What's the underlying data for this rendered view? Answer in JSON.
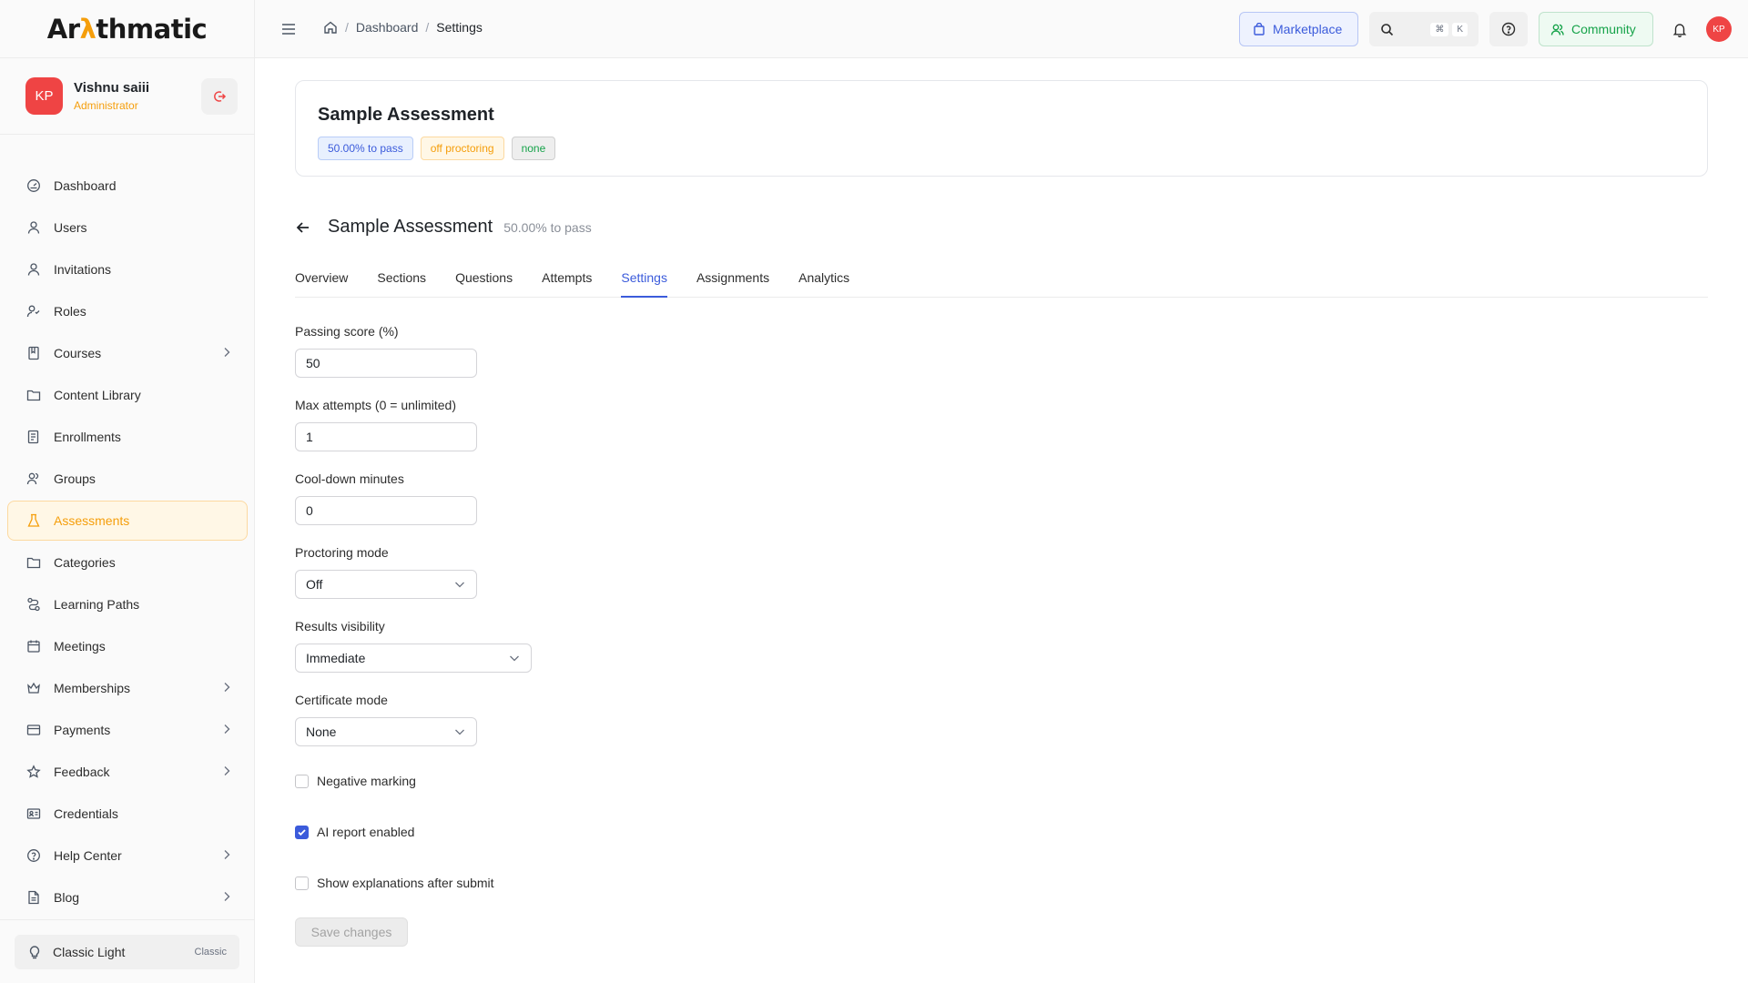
{
  "brand": {
    "logo_prefix": "Ar",
    "logo_accent": "λ",
    "logo_suffix": "thmatic"
  },
  "user": {
    "initials": "KP",
    "name": "Vishnu saiii",
    "role": "Administrator"
  },
  "sidebar": {
    "items": [
      {
        "label": "Dashboard",
        "icon": "dashboard-icon",
        "has_children": false
      },
      {
        "label": "Users",
        "icon": "user-icon",
        "has_children": false
      },
      {
        "label": "Invitations",
        "icon": "user-icon",
        "has_children": false
      },
      {
        "label": "Roles",
        "icon": "roles-icon",
        "has_children": false
      },
      {
        "label": "Courses",
        "icon": "book-icon",
        "has_children": true
      },
      {
        "label": "Content Library",
        "icon": "folder-icon",
        "has_children": false
      },
      {
        "label": "Enrollments",
        "icon": "enrollments-icon",
        "has_children": false
      },
      {
        "label": "Groups",
        "icon": "groups-icon",
        "has_children": false
      },
      {
        "label": "Assessments",
        "icon": "flask-icon",
        "has_children": false,
        "active": true
      },
      {
        "label": "Categories",
        "icon": "folder-icon",
        "has_children": false
      },
      {
        "label": "Learning Paths",
        "icon": "route-icon",
        "has_children": false
      },
      {
        "label": "Meetings",
        "icon": "calendar-icon",
        "has_children": false
      },
      {
        "label": "Memberships",
        "icon": "crown-icon",
        "has_children": true
      },
      {
        "label": "Payments",
        "icon": "card-icon",
        "has_children": true
      },
      {
        "label": "Feedback",
        "icon": "star-icon",
        "has_children": true
      },
      {
        "label": "Credentials",
        "icon": "id-card-icon",
        "has_children": false
      },
      {
        "label": "Help Center",
        "icon": "help-icon",
        "has_children": true
      },
      {
        "label": "Blog",
        "icon": "document-icon",
        "has_children": true
      }
    ],
    "theme": {
      "label": "Classic Light",
      "tag": "Classic"
    }
  },
  "header": {
    "breadcrumb": {
      "parent": "Dashboard",
      "current": "Settings"
    },
    "marketplace_label": "Marketplace",
    "shortcut_keys": [
      "⌘",
      "K"
    ],
    "community_label": "Community",
    "avatar_initials": "KP"
  },
  "summary": {
    "title": "Sample Assessment",
    "badges": [
      "50.00% to pass",
      "off proctoring",
      "none"
    ]
  },
  "page": {
    "title": "Sample Assessment",
    "subtitle": "50.00% to pass"
  },
  "tabs": [
    "Overview",
    "Sections",
    "Questions",
    "Attempts",
    "Settings",
    "Assignments",
    "Analytics"
  ],
  "active_tab": "Settings",
  "form": {
    "passing_score": {
      "label": "Passing score (%)",
      "value": "50"
    },
    "max_attempts": {
      "label": "Max attempts (0 = unlimited)",
      "value": "1"
    },
    "cooldown": {
      "label": "Cool-down minutes",
      "value": "0"
    },
    "proctoring": {
      "label": "Proctoring mode",
      "value": "Off"
    },
    "results_visibility": {
      "label": "Results visibility",
      "value": "Immediate"
    },
    "certificate": {
      "label": "Certificate mode",
      "value": "None"
    },
    "negative_marking": {
      "label": "Negative marking",
      "checked": false
    },
    "ai_report": {
      "label": "AI report enabled",
      "checked": true
    },
    "show_explanations": {
      "label": "Show explanations after submit",
      "checked": false
    },
    "save_label": "Save changes"
  },
  "colors": {
    "accent": "#f59e0b",
    "primary": "#3b5bdb",
    "success": "#16a34a",
    "avatar": "#ef4444"
  }
}
